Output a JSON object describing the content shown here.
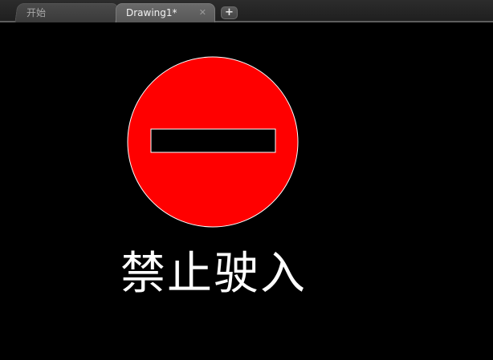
{
  "tabs": [
    {
      "label": "开始",
      "active": false
    },
    {
      "label": "Drawing1*",
      "active": true
    }
  ],
  "tab_close_symbol": "✕",
  "tab_add_symbol": "+",
  "drawing": {
    "sign_text": "禁止驶入",
    "colors": {
      "sign_fill": "#ff0000",
      "sign_outline": "#ffffff",
      "bar_fill": "#000000",
      "bar_outline": "#ffffff",
      "text": "#ffffff",
      "background": "#000000"
    }
  }
}
